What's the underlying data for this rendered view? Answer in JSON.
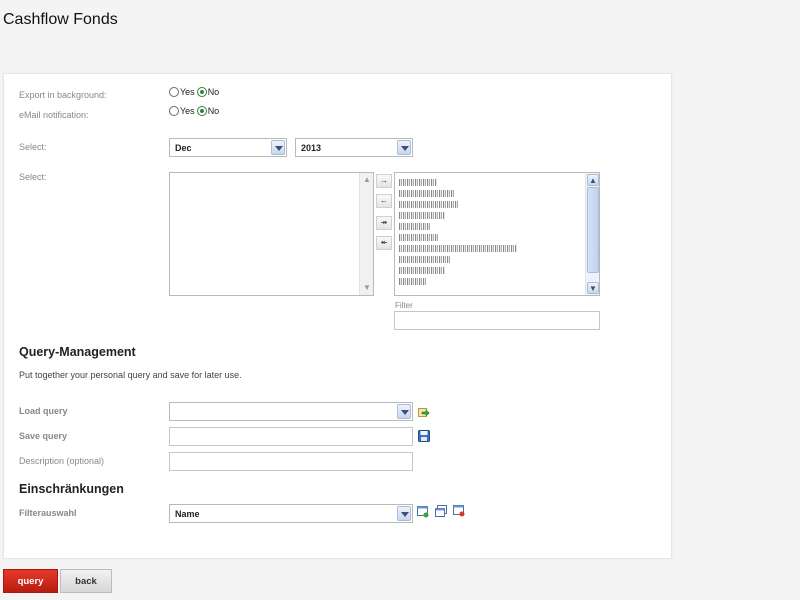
{
  "page": {
    "title": "Cashflow Fonds"
  },
  "export_bg": {
    "label": "Export in background:",
    "yes": "Yes",
    "no": "No",
    "selected": "No"
  },
  "email": {
    "label": "eMail notification:",
    "yes": "Yes",
    "no": "No",
    "selected": "No"
  },
  "period": {
    "label": "Select:",
    "month": "Dec",
    "year": "2013"
  },
  "list_select": {
    "label": "Select:",
    "move_right": "→",
    "move_left": "←",
    "move_all_right": "↠",
    "move_all_left": "↞",
    "filter_label": "Filter",
    "filter_value": ""
  },
  "query_mgmt": {
    "title": "Query-Management",
    "description": "Put together your personal query and save for later use.",
    "load_label": "Load query",
    "load_value": "",
    "save_label": "Save query",
    "save_value": "",
    "desc_label": "Description (optional)",
    "desc_value": ""
  },
  "restrictions": {
    "title": "Einschränkungen",
    "filter_label": "Filterauswahl",
    "filter_value": "Name"
  },
  "actions": {
    "query": "query",
    "back": "back"
  },
  "icons": {
    "load": "load-arrow-icon",
    "save": "floppy-disk-icon",
    "add_filter": "add-filter-icon",
    "copy_filter": "copy-filter-icon",
    "delete_filter": "delete-filter-icon"
  }
}
